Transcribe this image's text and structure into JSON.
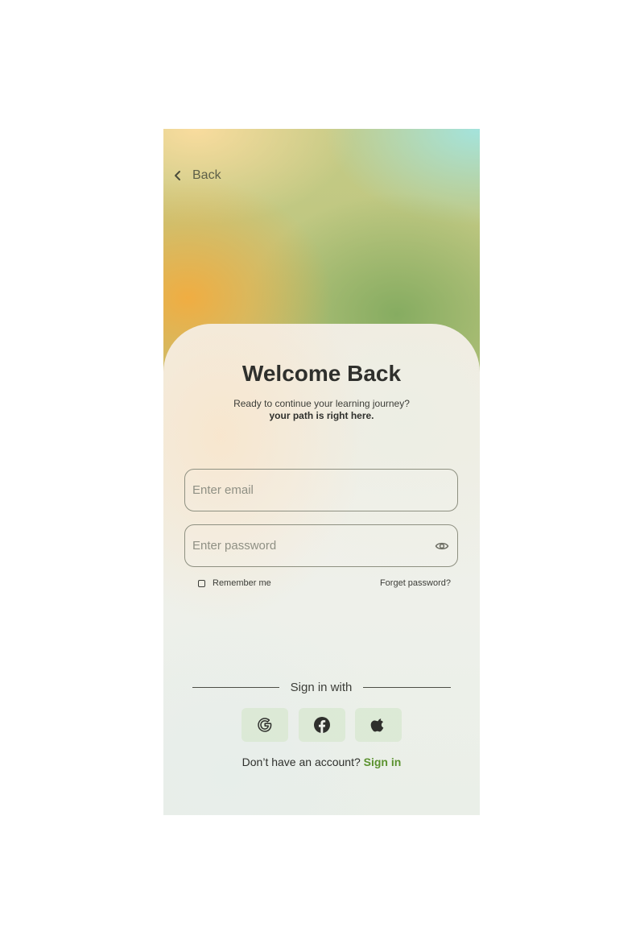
{
  "header": {
    "back_label": "Back",
    "back_icon": "chevron-left-icon"
  },
  "welcome": {
    "title": "Welcome Back",
    "subtitle": "Ready to continue your learning journey?",
    "subtitle_bold": "your path is right here."
  },
  "form": {
    "email_placeholder": "Enter email",
    "email_value": "",
    "password_placeholder": "Enter password",
    "password_value": "",
    "show_password_icon": "eye-icon",
    "remember_label": "Remember me",
    "remember_checked": false,
    "forgot_label": "Forget password?"
  },
  "social": {
    "divider_label": "Sign in with",
    "providers": [
      "google-icon",
      "facebook-icon",
      "apple-icon"
    ]
  },
  "footer": {
    "prompt": "Don’t have an account?",
    "link_label": "Sign in"
  },
  "colors": {
    "accent": "#5b922f",
    "text": "#2f302d",
    "field_border": "#8e9081",
    "social_bg": "#d6e7cd"
  }
}
